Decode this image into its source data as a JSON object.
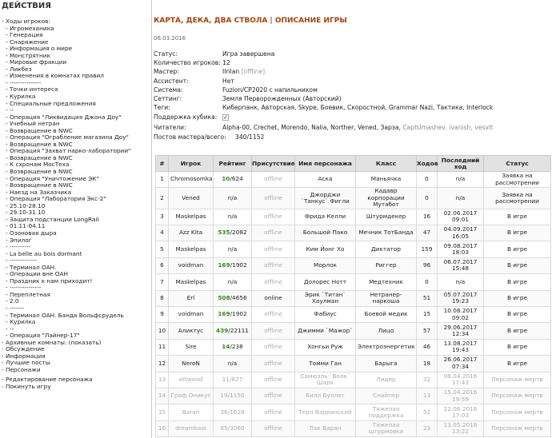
{
  "sidebar": {
    "title": "ДЕЙСТВИЯ",
    "items": [
      {
        "label": "- Ходы игроков:",
        "sub": false
      },
      {
        "label": "- Игромеханика",
        "sub": true
      },
      {
        "label": "- Генерация",
        "sub": true
      },
      {
        "label": "- Снаряжение",
        "sub": true
      },
      {
        "label": "- Информация о мире",
        "sub": true
      },
      {
        "label": "- Монстрятник",
        "sub": true
      },
      {
        "label": "- Мировые фракции",
        "sub": true
      },
      {
        "label": "- Ликбез",
        "sub": true
      },
      {
        "label": "- Изменения в комнатах правил",
        "sub": true
      },
      {
        "label": "- ---------------",
        "sub": true
      },
      {
        "label": "- Точки интереса",
        "sub": true
      },
      {
        "label": "- Курилка",
        "sub": true
      },
      {
        "label": "- Специальные предложения",
        "sub": true
      },
      {
        "label": "- --",
        "sub": true
      },
      {
        "label": "- Операция \"Ликвидация Джона Доу\"",
        "sub": true
      },
      {
        "label": "- Учебный нетран",
        "sub": true
      },
      {
        "label": "- Возвращение в NWC",
        "sub": true
      },
      {
        "label": "- Операция \"Ограбление магазина Доу\"",
        "sub": true
      },
      {
        "label": "- Возвращение в NWC",
        "sub": true
      },
      {
        "label": "- Операция \"Захват нарко-лаборатории\"",
        "sub": true
      },
      {
        "label": "- Возвращение в NWC",
        "sub": true
      },
      {
        "label": "- К схронам МосТеха",
        "sub": true
      },
      {
        "label": "- Возвращение в NWC",
        "sub": true
      },
      {
        "label": "- Операция \"Уничтожение ЭК\"",
        "sub": true
      },
      {
        "label": "- Возвращение в NWC",
        "sub": true
      },
      {
        "label": "- Наезд на Заказчика",
        "sub": true
      },
      {
        "label": "- Операция \"Лаборатория Экс-2\"",
        "sub": true
      },
      {
        "label": "- 25.10-28.10",
        "sub": true
      },
      {
        "label": "- 29.10-31.10",
        "sub": true
      },
      {
        "label": "- Защита подстанции LongRail",
        "sub": true
      },
      {
        "label": "- 01.11-04.11",
        "sub": true
      },
      {
        "label": "- Озоновая дыра",
        "sub": true
      },
      {
        "label": "- Эпилог",
        "sub": true
      },
      {
        "label": "- ----------",
        "sub": true
      },
      {
        "label": "- La belle au bois dormant",
        "sub": true
      },
      {
        "label": "- -------------",
        "sub": true
      },
      {
        "label": "- Терминал OAH.",
        "sub": true
      },
      {
        "label": "- Операции вне ОАН",
        "sub": true
      },
      {
        "label": "- Праздник к нам приходит!",
        "sub": true
      },
      {
        "label": "- ---------------",
        "sub": true
      },
      {
        "label": "- Переплетная",
        "sub": true
      },
      {
        "label": "- 2.0",
        "sub": true
      },
      {
        "label": "- -------",
        "sub": true
      },
      {
        "label": "- Терминал OAH. Банда Вольфсрудель",
        "sub": true
      },
      {
        "label": "- Курилка",
        "sub": true
      },
      {
        "label": "- --",
        "sub": true
      },
      {
        "label": "- Операция \"Лайнер-17\"",
        "sub": true
      },
      {
        "label": "- Архивные комнаты: (показать)",
        "sub": false
      },
      {
        "label": "- Обсуждение",
        "sub": false
      },
      {
        "label": "- Информация",
        "sub": false
      },
      {
        "label": "- Лучшие посты",
        "sub": false
      },
      {
        "label": "- Персонажи",
        "sub": false
      },
      {
        "label": "- Редактирование персонажа",
        "sub": false,
        "gap": true
      },
      {
        "label": "- Покинуть игру",
        "sub": false
      }
    ]
  },
  "page": {
    "title": "КАРТА, ДЕКА, ДВА СТВОЛА | ОПИСАНИЕ ИГРЫ",
    "date": "06.03.2016"
  },
  "info": {
    "status_label": "Статус:",
    "status": "Игра завершена",
    "players_label": "Количество игроков:",
    "players": "12",
    "master_label": "Мастер:",
    "master": "Ilrilan",
    "master_state": "[offline]",
    "assistant_label": "Ассистент:",
    "assistant": "Нет",
    "system_label": "Система:",
    "system": "Fuzion/CP2020 с напильником",
    "setting_label": "Сеттинг:",
    "setting": "Земля Перворожденных (Авторский)",
    "tags_label": "Теги:",
    "tags": "Киберпанк, Авторская, Skype, Боевик, Скоростной, Grammar Nazi, Тактика, Interlock",
    "cube_label": "Поддержка кубика:",
    "cube": "✓",
    "readers_label": "Читатели:",
    "readers": "Alpha-00, Crechet, Morendo, Nalia, Norther, Vened, Зарза,",
    "readers_gray": "CaptUmashev, ivanish, vesvit",
    "posts_label": "Постов мастера/всего:",
    "posts": "340/1152"
  },
  "table": {
    "headers": [
      "#",
      "Игрок",
      "Рейтинг",
      "Присутствие",
      "Имя персонажа",
      "Класс",
      "Ходов",
      "Последний ход",
      "Статус"
    ],
    "rows": [
      {
        "n": "1",
        "player": "Chromosomka",
        "rating": "10",
        "ratingTotal": "/624",
        "presence": "offline",
        "char": "Аска",
        "cls": "Маньячка",
        "moves": "0",
        "last": "n/a",
        "status": "Заявка на рассмотрении",
        "kind": "pend"
      },
      {
        "n": "2",
        "player": "Vened",
        "rating": "",
        "ratingTotal": "n/a",
        "presence": "offline",
        "char": "Джорджи `Танкус` Фигли",
        "cls": "Кадавр корпорации Мутабот",
        "moves": "0",
        "last": "n/a",
        "status": "Заявка на рассмотрении",
        "kind": "pend"
      },
      {
        "n": "3",
        "player": "Maskelpas",
        "rating": "",
        "ratingTotal": "n/a",
        "presence": "offline",
        "char": "Фрида Келли",
        "cls": "Штурмдекер",
        "moves": "16",
        "last": "02.06.2017 09:01",
        "status": "В игре",
        "kind": "play"
      },
      {
        "n": "4",
        "player": "Azz Kita",
        "rating": "535",
        "ratingTotal": "/2082",
        "presence": "offline",
        "char": "Большой Пако",
        "cls": "Мечник ТотБанда",
        "moves": "47",
        "last": "04.09.2017 16:05",
        "status": "В игре",
        "kind": "play"
      },
      {
        "n": "5",
        "player": "Maskelpas",
        "rating": "",
        "ratingTotal": "n/a",
        "presence": "offline",
        "char": "Ким Йонг Хо",
        "cls": "Диктатор",
        "moves": "159",
        "last": "09.08.2017 18:03",
        "status": "В игре",
        "kind": "play"
      },
      {
        "n": "6",
        "player": "voidman",
        "rating": "169",
        "ratingTotal": "/1902",
        "presence": "offline",
        "char": "Морлок",
        "cls": "Риггер",
        "moves": "96",
        "last": "06.07.2017 15:48",
        "status": "В игре",
        "kind": "play"
      },
      {
        "n": "7",
        "player": "Maskelpas",
        "rating": "",
        "ratingTotal": "n/a",
        "presence": "offline",
        "char": "Долорес Нотт",
        "cls": "Медтехник",
        "moves": "0",
        "last": "n/a",
        "status": "В игре",
        "kind": "play"
      },
      {
        "n": "8",
        "player": "Erl",
        "rating": "508",
        "ratingTotal": "/4656",
        "presence": "online",
        "char": "Эрик `Титан` Хаулман",
        "cls": "Нетранер-наркоша",
        "moves": "51",
        "last": "05.07.2017 19:23",
        "status": "В игре",
        "kind": "play"
      },
      {
        "n": "9",
        "player": "voidman",
        "rating": "169",
        "ratingTotal": "/1902",
        "presence": "offline",
        "char": "Фабиус",
        "cls": "Боевой медик",
        "moves": "15",
        "last": "10.08.2017 09:02",
        "status": "В игре",
        "kind": "play"
      },
      {
        "n": "10",
        "player": "Аликтус",
        "rating": "439",
        "ratingTotal": "/22111",
        "presence": "offline",
        "char": "Джимми `Мажор`",
        "cls": "Лицо",
        "moves": "57",
        "last": "29.06.2017 12:34",
        "status": "В игре",
        "kind": "play"
      },
      {
        "n": "11",
        "player": "Sire",
        "rating": "14",
        "ratingTotal": "/238",
        "presence": "offline",
        "char": "Хонгьи Руж",
        "cls": "Электроэнергетик",
        "moves": "46",
        "last": "13.08.2017 19:43",
        "status": "В игре",
        "kind": "play"
      },
      {
        "n": "12",
        "player": "NeroN",
        "rating": "",
        "ratingTotal": "n/a",
        "presence": "offline",
        "char": "Томми Ган",
        "cls": "Барыга",
        "moves": "18",
        "last": "26.06.2017 07:34",
        "status": "В игре",
        "kind": "play"
      },
      {
        "n": "13",
        "player": "attwood",
        "rating": "11",
        "ratingTotal": "/827",
        "presence": "offline",
        "char": "Самюэль `Волк` Шарк",
        "cls": "Лидер",
        "moves": "32",
        "last": "08.04.2016 17:43",
        "status": "Персонаж мертв",
        "kind": "dead"
      },
      {
        "n": "14",
        "player": "Граф Оникус",
        "rating": "19",
        "ratingTotal": "/1150",
        "presence": "offline",
        "char": "Билл Буллет",
        "cls": "Снайпер",
        "moves": "13",
        "last": "15.04.2016 19:59",
        "status": "Персонаж мертв",
        "kind": "dead"
      },
      {
        "n": "15",
        "player": "Baran",
        "rating": "36",
        "ratingTotal": "/1628",
        "presence": "offline",
        "char": "Терл Варранский",
        "cls": "Тяжелая поддержка",
        "moves": "52",
        "last": "22.06.2016 17:03",
        "status": "Персонаж мертв",
        "kind": "dead"
      },
      {
        "n": "16",
        "player": "dreamkast",
        "rating": "65",
        "ratingTotal": "/3060",
        "presence": "offline",
        "char": "Лак Варан",
        "cls": "Тяжелая штурмовка",
        "moves": "23",
        "last": "13.05.2016 13:22",
        "status": "Персонаж мертв",
        "kind": "dead"
      }
    ]
  }
}
